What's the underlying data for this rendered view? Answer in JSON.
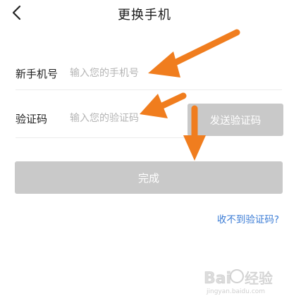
{
  "header": {
    "back_icon": "chevron-left-icon",
    "title": "更换手机"
  },
  "form": {
    "phone": {
      "label": "新手机号",
      "placeholder": "输入您的手机号",
      "value": ""
    },
    "code": {
      "label": "验证码",
      "placeholder": "输入您的验证码",
      "value": "",
      "send_button_label": "发送验证码"
    },
    "submit_label": "完成",
    "no_code_link": "收不到验证码?"
  },
  "colors": {
    "disabled_button": "#c9c9c9",
    "link": "#3a7bd5",
    "annotation_arrow": "#f07d1e"
  },
  "watermark": {
    "brand": "Bai 经验",
    "url": "jingyan.baidu.com"
  }
}
